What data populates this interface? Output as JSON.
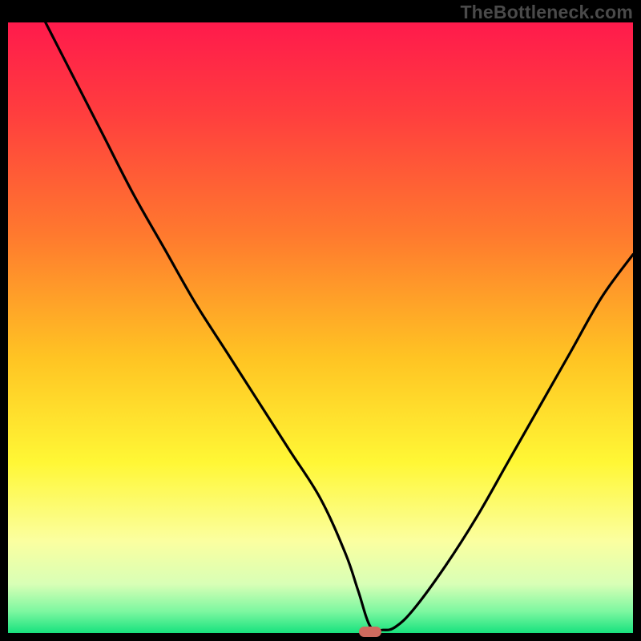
{
  "watermark": "TheBottleneck.com",
  "colors": {
    "black": "#000000",
    "curve": "#000000",
    "marker": "#cf6a5e",
    "gradient_stops": [
      {
        "offset": 0.0,
        "color": "#ff1a4c"
      },
      {
        "offset": 0.15,
        "color": "#ff3e3e"
      },
      {
        "offset": 0.35,
        "color": "#ff7a2e"
      },
      {
        "offset": 0.55,
        "color": "#ffc423"
      },
      {
        "offset": 0.72,
        "color": "#fff735"
      },
      {
        "offset": 0.85,
        "color": "#fbffa0"
      },
      {
        "offset": 0.92,
        "color": "#d8ffb6"
      },
      {
        "offset": 0.965,
        "color": "#7cf7a0"
      },
      {
        "offset": 1.0,
        "color": "#18e27e"
      }
    ]
  },
  "chart_data": {
    "type": "line",
    "title": "",
    "xlabel": "",
    "ylabel": "",
    "xlim": [
      0,
      100
    ],
    "ylim": [
      0,
      100
    ],
    "grid": false,
    "legend": false,
    "marker": {
      "x": 58,
      "y": 0
    },
    "series": [
      {
        "name": "bottleneck-curve",
        "x": [
          6,
          10,
          15,
          20,
          25,
          30,
          35,
          40,
          45,
          50,
          54,
          56,
          58,
          60,
          62,
          65,
          70,
          75,
          80,
          85,
          90,
          95,
          100
        ],
        "y": [
          100,
          92,
          82,
          72,
          63,
          54,
          46,
          38,
          30,
          22,
          13,
          7,
          1,
          0.5,
          1,
          4,
          11,
          19,
          28,
          37,
          46,
          55,
          62
        ]
      }
    ]
  }
}
